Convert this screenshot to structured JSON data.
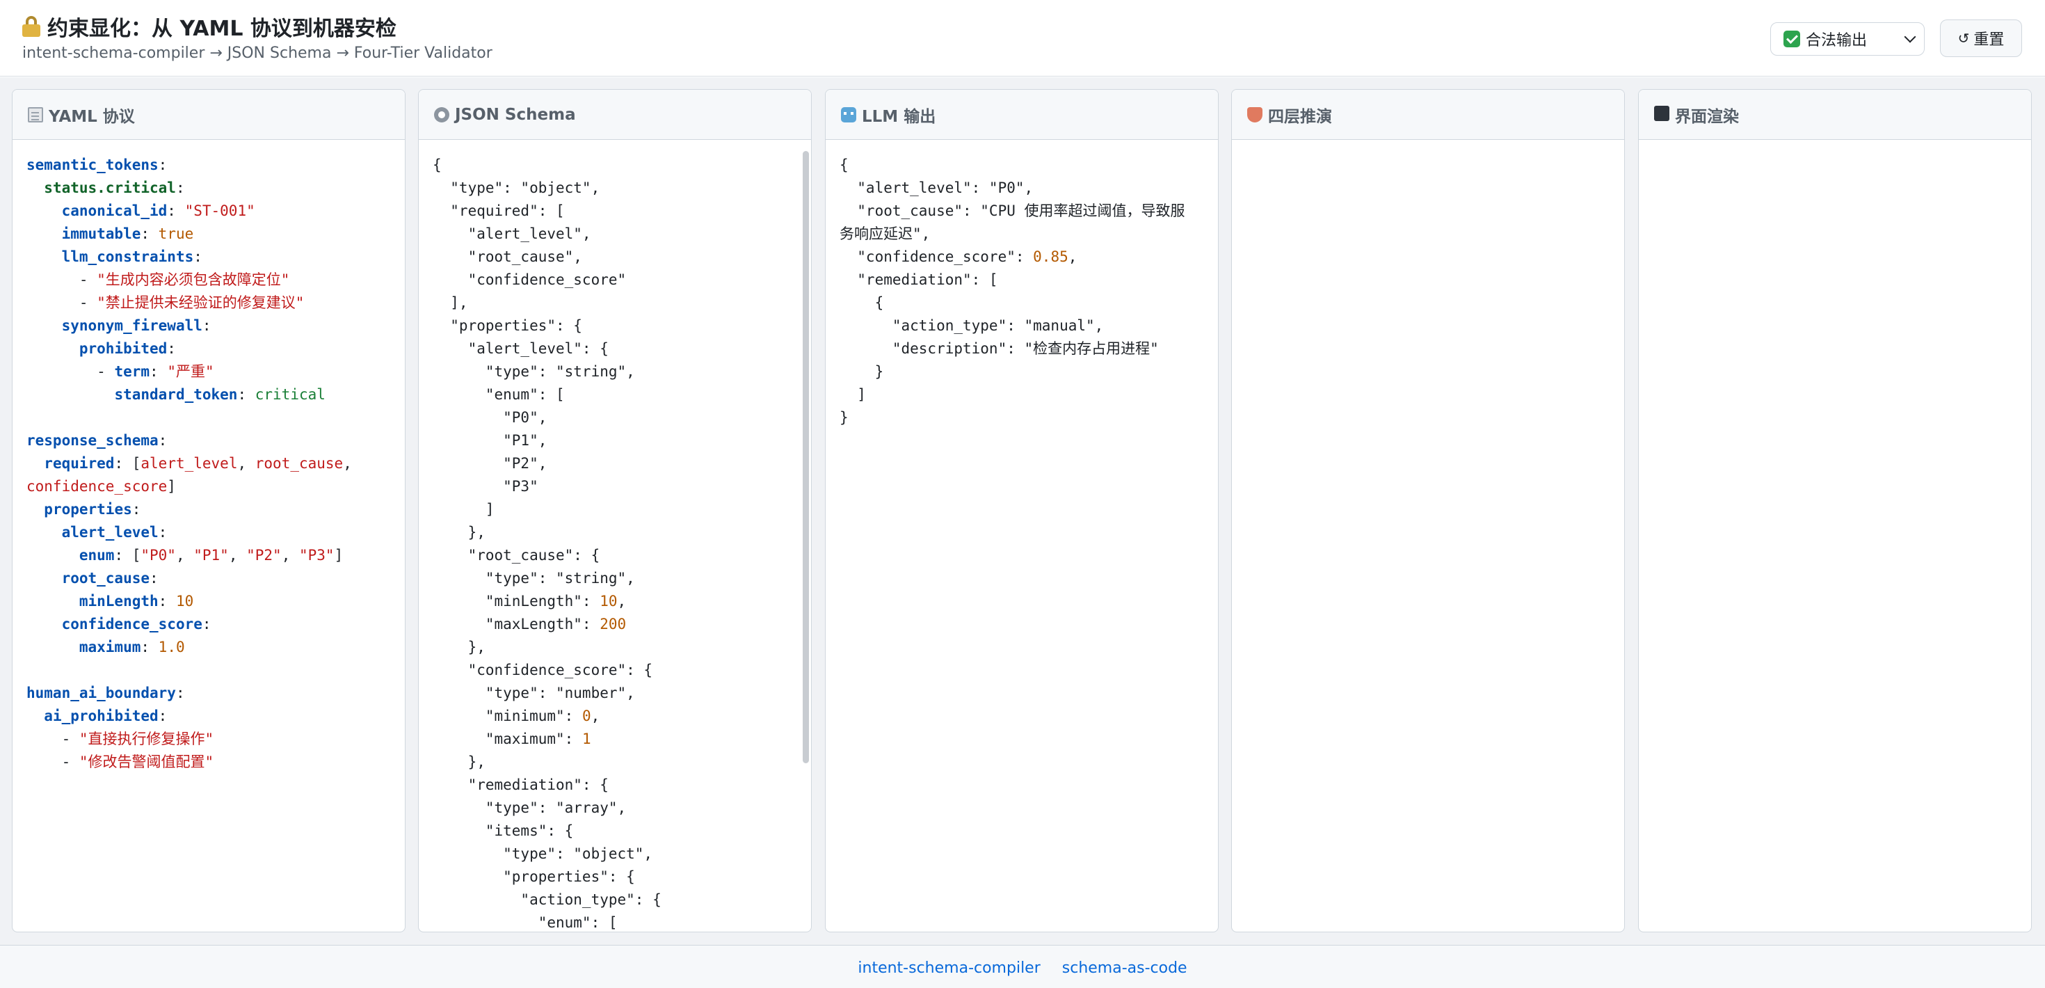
{
  "header": {
    "title": "约束显化：从 YAML 协议到机器安检",
    "subtitle": "intent-schema-compiler → JSON Schema → Four-Tier Validator",
    "mode_select": {
      "selected": "合法输出"
    },
    "reset_label": "重置",
    "reset_icon": "↺"
  },
  "panels": [
    {
      "title": "YAML 协议",
      "icon": "document-icon"
    },
    {
      "title": "JSON Schema",
      "icon": "gear-icon"
    },
    {
      "title": "LLM 输出",
      "icon": "robot-icon"
    },
    {
      "title": "四层推演",
      "icon": "shield-icon"
    },
    {
      "title": "界面渲染",
      "icon": "monitor-icon"
    }
  ],
  "yaml": {
    "semantic_tokens": "semantic_tokens",
    "status_critical": "status.critical",
    "canonical_id_key": "canonical_id",
    "canonical_id_val": "\"ST-001\"",
    "immutable_key": "immutable",
    "immutable_val": "true",
    "llm_constraints_key": "llm_constraints",
    "constraint_1": "\"生成内容必须包含故障定位\"",
    "constraint_2": "\"禁止提供未经验证的修复建议\"",
    "synonym_firewall": "synonym_firewall",
    "prohibited": "prohibited",
    "term_key": "term",
    "term_val": "\"严重\"",
    "standard_token_key": "standard_token",
    "standard_token_val": "critical",
    "response_schema": "response_schema",
    "required_key": "required",
    "req_1": "alert_level",
    "req_2": "root_cause",
    "req_3": "confidence_score",
    "properties": "properties",
    "alert_level": "alert_level",
    "enum_key": "enum",
    "enum_1": "\"P0\"",
    "enum_2": "\"P1\"",
    "enum_3": "\"P2\"",
    "enum_4": "\"P3\"",
    "root_cause": "root_cause",
    "minLength_key": "minLength",
    "minLength_val": "10",
    "confidence_score": "confidence_score",
    "maximum_key": "maximum",
    "maximum_val": "1.0",
    "human_ai_boundary": "human_ai_boundary",
    "ai_prohibited": "ai_prohibited",
    "prohibited_1": "\"直接执行修复操作\"",
    "prohibited_2": "\"修改告警阈值配置\""
  },
  "schema": {
    "lines": [
      "{",
      "  \"type\": \"object\",",
      "  \"required\": [",
      "    \"alert_level\",",
      "    \"root_cause\",",
      "    \"confidence_score\"",
      "  ],",
      "  \"properties\": {",
      "    \"alert_level\": {",
      "      \"type\": \"string\",",
      "      \"enum\": [",
      "        \"P0\",",
      "        \"P1\",",
      "        \"P2\",",
      "        \"P3\"",
      "      ]",
      "    },",
      "    \"root_cause\": {",
      "      \"type\": \"string\",",
      "      \"minLength\": 10,",
      "      \"maxLength\": 200",
      "    },",
      "    \"confidence_score\": {",
      "      \"type\": \"number\",",
      "      \"minimum\": 0,",
      "      \"maximum\": 1",
      "    },",
      "    \"remediation\": {",
      "      \"type\": \"array\",",
      "      \"items\": {",
      "        \"type\": \"object\",",
      "        \"properties\": {",
      "          \"action_type\": {",
      "            \"enum\": ["
    ]
  },
  "llm_output": {
    "lines": [
      "{",
      "  \"alert_level\": \"P0\",",
      "  \"root_cause\": \"CPU 使用率超过阈值，导致服",
      "务响应延迟\",",
      "  \"confidence_score\": 0.85,",
      "  \"remediation\": [",
      "    {",
      "      \"action_type\": \"manual\",",
      "      \"description\": \"检查内存占用进程\"",
      "    }",
      "  ]",
      "}"
    ]
  },
  "footer": {
    "link_1": "intent-schema-compiler",
    "link_2": "schema-as-code"
  }
}
